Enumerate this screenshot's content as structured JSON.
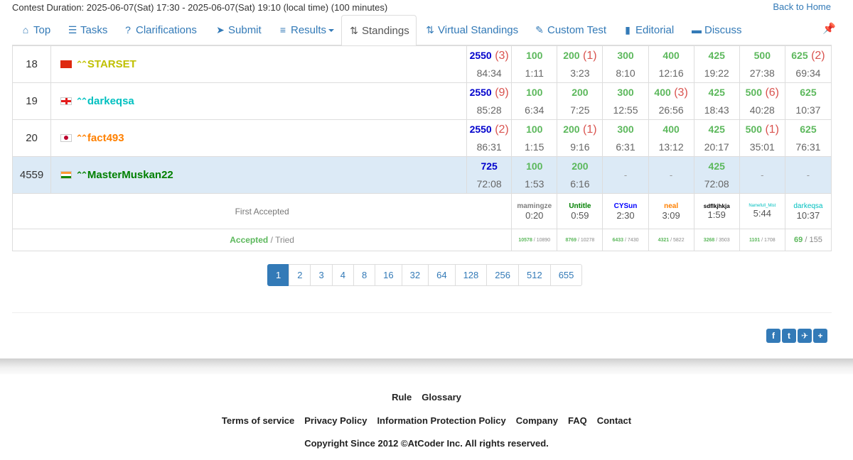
{
  "header": {
    "duration": "Contest Duration: 2025-06-07(Sat) 17:30 - 2025-06-07(Sat) 19:10 (local time) (100 minutes)",
    "back_home": "Back to Home"
  },
  "tabs": [
    {
      "label": "Top",
      "icon": "home-icon"
    },
    {
      "label": "Tasks",
      "icon": "tasks-icon"
    },
    {
      "label": "Clarifications",
      "icon": "question-icon"
    },
    {
      "label": "Submit",
      "icon": "send-icon"
    },
    {
      "label": "Results",
      "icon": "list-icon"
    },
    {
      "label": "Standings",
      "icon": "sort-icon"
    },
    {
      "label": "Virtual Standings",
      "icon": "sort-icon"
    },
    {
      "label": "Custom Test",
      "icon": "wrench-icon"
    },
    {
      "label": "Editorial",
      "icon": "book-icon"
    },
    {
      "label": "Discuss",
      "icon": "comment-icon"
    }
  ],
  "rows": [
    {
      "rank": "18",
      "user": "STARSET",
      "flag": "cn",
      "color": "#c0c000",
      "total": "2550",
      "total_pen": "(3)",
      "total_time": "84:34",
      "problems": [
        {
          "score": "100",
          "pen": "",
          "time": "1:11"
        },
        {
          "score": "200",
          "pen": "(1)",
          "time": "3:23"
        },
        {
          "score": "300",
          "pen": "",
          "time": "8:10"
        },
        {
          "score": "400",
          "pen": "",
          "time": "12:16"
        },
        {
          "score": "425",
          "pen": "",
          "time": "19:22"
        },
        {
          "score": "500",
          "pen": "",
          "time": "27:38"
        },
        {
          "score": "625",
          "pen": "(2)",
          "time": "69:34"
        }
      ]
    },
    {
      "rank": "19",
      "user": "darkeqsa",
      "flag": "ge",
      "color": "#00c0c0",
      "total": "2550",
      "total_pen": "(9)",
      "total_time": "85:28",
      "problems": [
        {
          "score": "100",
          "pen": "",
          "time": "6:34"
        },
        {
          "score": "200",
          "pen": "",
          "time": "7:25"
        },
        {
          "score": "300",
          "pen": "",
          "time": "12:55"
        },
        {
          "score": "400",
          "pen": "(3)",
          "time": "26:56"
        },
        {
          "score": "425",
          "pen": "",
          "time": "18:43"
        },
        {
          "score": "500",
          "pen": "(6)",
          "time": "40:28"
        },
        {
          "score": "625",
          "pen": "",
          "time": "10:37"
        }
      ]
    },
    {
      "rank": "20",
      "user": "fact493",
      "flag": "jp",
      "color": "#ff8000",
      "total": "2550",
      "total_pen": "(2)",
      "total_time": "86:31",
      "problems": [
        {
          "score": "100",
          "pen": "",
          "time": "1:15"
        },
        {
          "score": "200",
          "pen": "(1)",
          "time": "9:16"
        },
        {
          "score": "300",
          "pen": "",
          "time": "6:31"
        },
        {
          "score": "400",
          "pen": "",
          "time": "13:12"
        },
        {
          "score": "425",
          "pen": "",
          "time": "20:17"
        },
        {
          "score": "500",
          "pen": "(1)",
          "time": "35:01"
        },
        {
          "score": "625",
          "pen": "",
          "time": "76:31"
        }
      ]
    },
    {
      "rank": "4559",
      "user": "MasterMuskan22",
      "flag": "in",
      "color": "#008000",
      "total": "725",
      "total_pen": "",
      "total_time": "72:08",
      "problems": [
        {
          "score": "100",
          "pen": "",
          "time": "1:53"
        },
        {
          "score": "200",
          "pen": "",
          "time": "6:16"
        },
        {
          "score": "-",
          "pen": "",
          "time": ""
        },
        {
          "score": "-",
          "pen": "",
          "time": ""
        },
        {
          "score": "425",
          "pen": "",
          "time": "72:08"
        },
        {
          "score": "-",
          "pen": "",
          "time": ""
        },
        {
          "score": "-",
          "pen": "",
          "time": ""
        }
      ]
    }
  ],
  "first_accepted": {
    "label": "First Accepted",
    "cells": [
      {
        "name": "mamingze",
        "color": "#808080",
        "time": "0:20"
      },
      {
        "name": "Untitle",
        "color": "#008000",
        "time": "0:59"
      },
      {
        "name": "CYSun",
        "color": "#0000ff",
        "time": "2:30"
      },
      {
        "name": "neal",
        "color": "#ff8000",
        "time": "3:09"
      },
      {
        "name": "sdflkjhkja",
        "color": "#000000",
        "time": "1:59"
      },
      {
        "name": "Namefull_Mist",
        "color": "#00c0c0",
        "time": "5:44"
      },
      {
        "name": "darkeqsa",
        "color": "#00c0c0",
        "time": "10:37"
      }
    ]
  },
  "accepted_tried": {
    "accepted_label": "Accepted",
    "sep": " / ",
    "tried_label": "Tried",
    "cells": [
      {
        "acc": "10578",
        "tried": "10890"
      },
      {
        "acc": "8769",
        "tried": "10278"
      },
      {
        "acc": "6433",
        "tried": "7430"
      },
      {
        "acc": "4321",
        "tried": "5822"
      },
      {
        "acc": "3268",
        "tried": "3503"
      },
      {
        "acc": "1101",
        "tried": "1708"
      },
      {
        "acc": "69",
        "tried": "155"
      }
    ]
  },
  "pagination": [
    "1",
    "2",
    "3",
    "4",
    "8",
    "16",
    "32",
    "64",
    "128",
    "256",
    "512",
    "655"
  ],
  "share": [
    "f",
    "t",
    "✈",
    "+"
  ],
  "footer": {
    "row1": [
      "Rule",
      "Glossary"
    ],
    "row2": [
      "Terms of service",
      "Privacy Policy",
      "Information Protection Policy",
      "Company",
      "FAQ",
      "Contact"
    ],
    "copyright_prefix": "Copyright Since 2012 ©",
    "copyright_brand": "AtCoder Inc.",
    "copyright_suffix": " All rights reserved."
  }
}
